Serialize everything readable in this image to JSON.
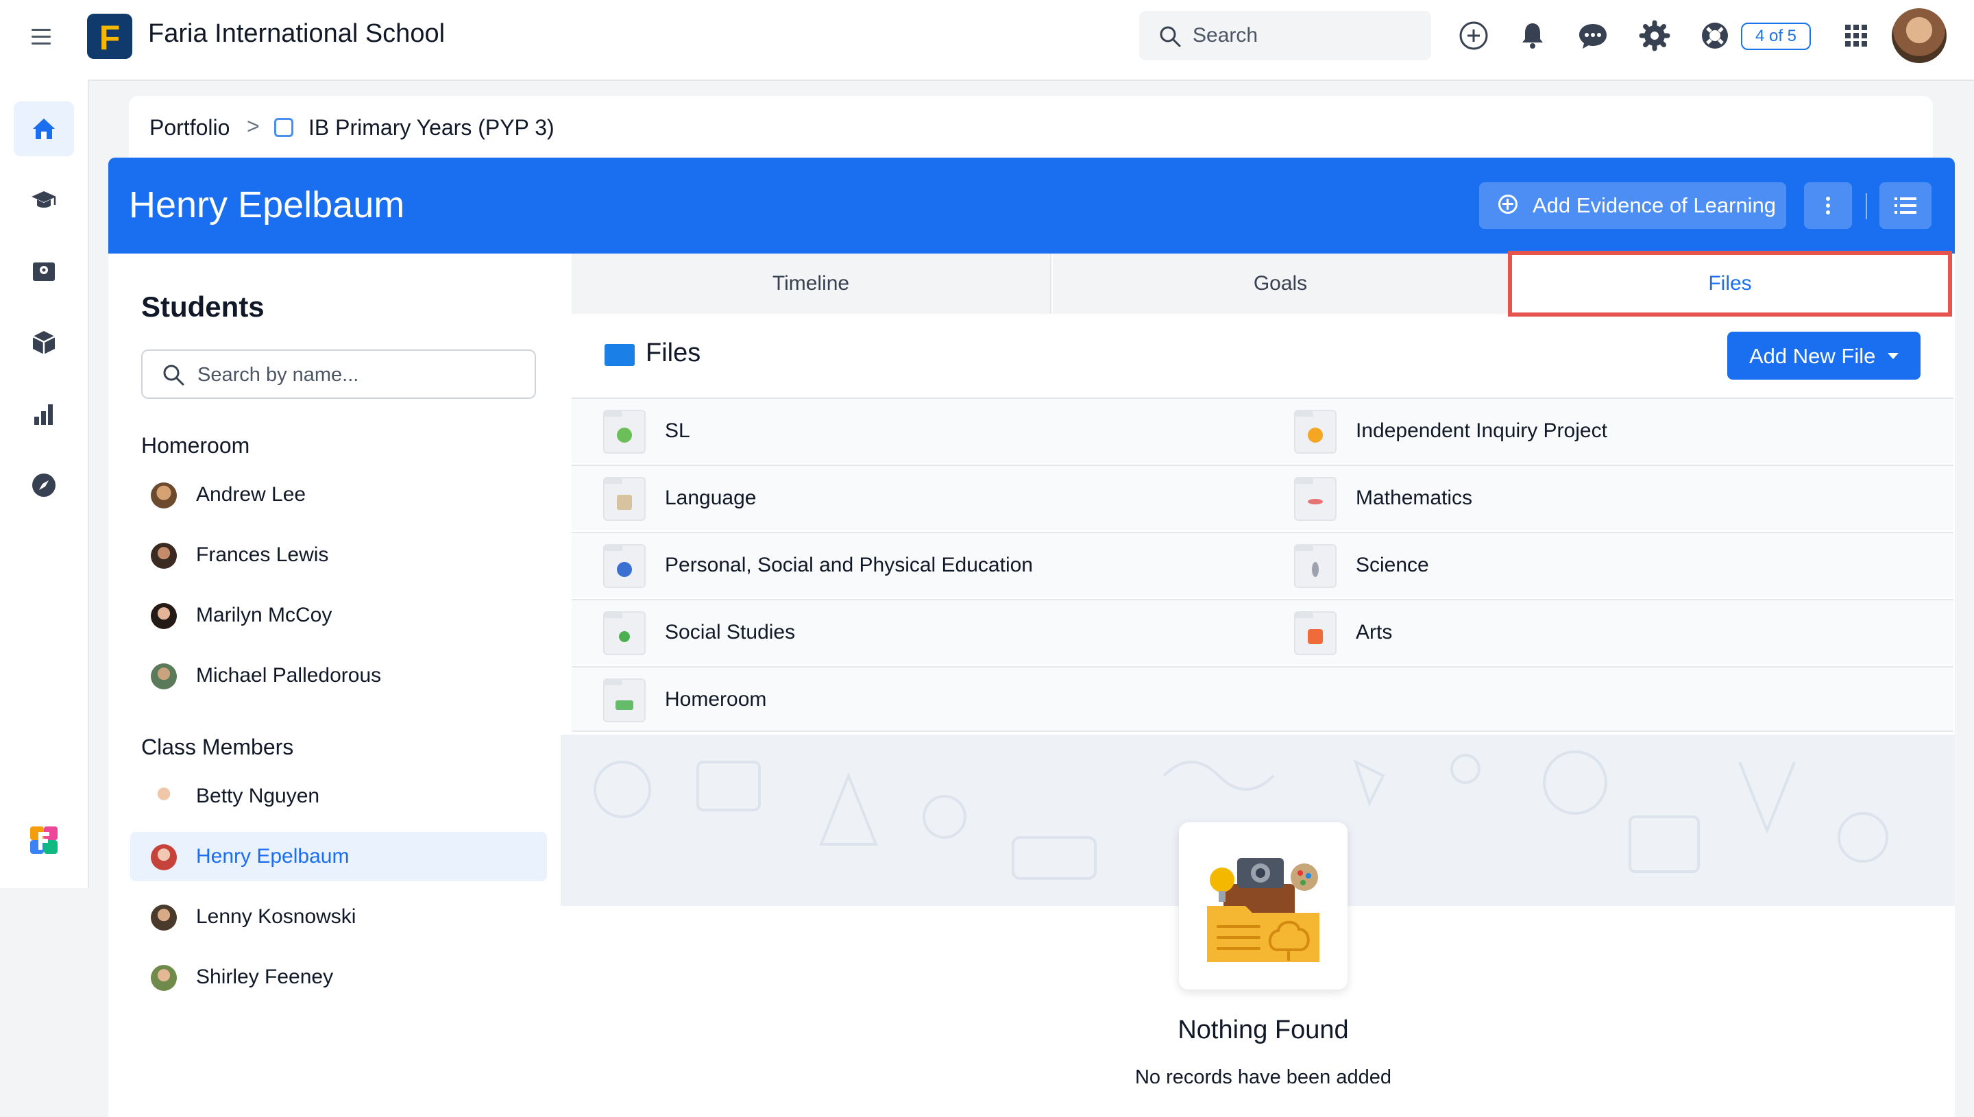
{
  "topbar": {
    "school_name": "Faria International School",
    "logo_letter": "F",
    "search_placeholder": "Search",
    "help_badge": "4 of 5",
    "icons": [
      "menu-icon",
      "add-circle-icon",
      "bell-icon",
      "chat-icon",
      "gear-icon",
      "lifebuoy-icon",
      "apps-grid-icon"
    ]
  },
  "rail": {
    "items": [
      "home-icon",
      "graduation-cap-icon",
      "map-book-icon",
      "cube-icon",
      "bar-chart-icon",
      "compass-icon",
      "faria-apps-icon"
    ],
    "active": "home-icon"
  },
  "breadcrumb": {
    "root": "Portfolio",
    "separator": ">",
    "current": "IB Primary Years (PYP 3)"
  },
  "header": {
    "student_name": "Henry Epelbaum",
    "add_evidence_label": "Add Evidence of Learning",
    "colors": {
      "primary": "#1a6ff0",
      "highlight": "#e5554d"
    }
  },
  "students": {
    "title": "Students",
    "search_placeholder": "Search by name...",
    "groups": [
      {
        "label": "Homeroom",
        "members": [
          "Andrew Lee",
          "Frances Lewis",
          "Marilyn McCoy",
          "Michael Palledorous"
        ]
      },
      {
        "label": "Class Members",
        "members": [
          "Betty Nguyen",
          "Henry Epelbaum",
          "Lenny Kosnowski",
          "Shirley Feeney"
        ]
      }
    ],
    "selected": "Henry Epelbaum"
  },
  "tabs": [
    "Timeline",
    "Goals",
    "Files"
  ],
  "active_tab": "Files",
  "files": {
    "heading": "Files",
    "add_button": "Add New File",
    "folders": [
      [
        "SL",
        "Independent Inquiry Project"
      ],
      [
        "Language",
        "Mathematics"
      ],
      [
        "Personal, Social and Physical Education",
        "Science"
      ],
      [
        "Social Studies",
        "Arts"
      ],
      [
        "Homeroom",
        ""
      ]
    ]
  },
  "empty_state": {
    "title": "Nothing Found",
    "subtitle": "No records have been added"
  }
}
